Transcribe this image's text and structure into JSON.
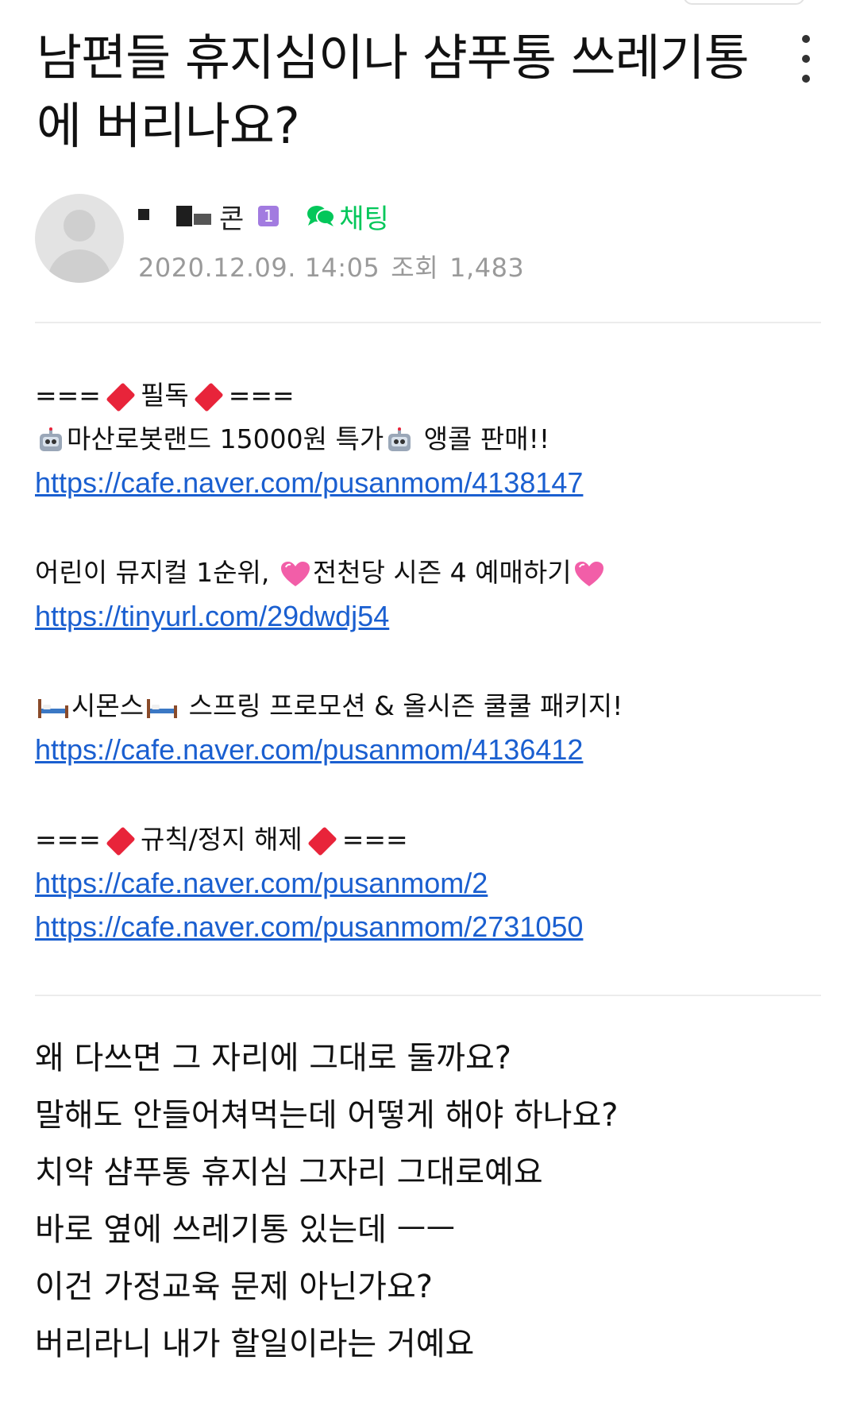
{
  "post": {
    "title": "남편들 휴지심이나 샴푸통 쓰레기통에 버리나요?",
    "author_suffix": "콘",
    "level_badge": "1",
    "chat_label": "채팅",
    "date": "2020.12.09. 14:05",
    "views_label": "조회",
    "views": "1,483"
  },
  "notice": {
    "header1_left": "===",
    "header1_text": "필독",
    "header1_right": "===",
    "robot_text": "마산로봇랜드 15000원 특가",
    "robot_tail": " 앵콜 판매!!",
    "link1": "https://cafe.naver.com/pusanmom/4138147",
    "musical_text": "어린이 뮤지컬 1순위, ",
    "musical_mid": "전천당 시즌 4 예매하기",
    "link2": "https://tinyurl.com/29dwdj54",
    "simmons_text": "시몬스",
    "simmons_tail": " 스프링 프로모션 & 올시즌 쿨쿨 패키지!",
    "link3": "https://cafe.naver.com/pusanmom/4136412",
    "header2_left": "===",
    "header2_text": "규칙/정지 해제",
    "header2_right": "===",
    "link4": "https://cafe.naver.com/pusanmom/2",
    "link5": "https://cafe.naver.com/pusanmom/2731050"
  },
  "body_lines": [
    "왜 다쓰면 그 자리에 그대로 둘까요?",
    "말해도 안들어쳐먹는데 어떻게 해야 하나요?",
    "치약 샴푸통 휴지심 그자리 그대로예요",
    "바로 옆에 쓰레기통 있는데 ㅡㅡ",
    "이건 가정교육 문제 아닌가요?",
    "버리라니 내가 할일이라는 거예요"
  ],
  "icons": {
    "more": "more-vertical-icon",
    "chat": "chat-bubble-icon",
    "diamond": "red-diamond-emoji",
    "robot": "robot-emoji",
    "heart": "pink-heart-emoji",
    "bed": "bed-emoji"
  },
  "colors": {
    "link": "#1a5fd0",
    "chat": "#03c75a",
    "badge": "#a27be0",
    "meta": "#9a9a9a"
  }
}
